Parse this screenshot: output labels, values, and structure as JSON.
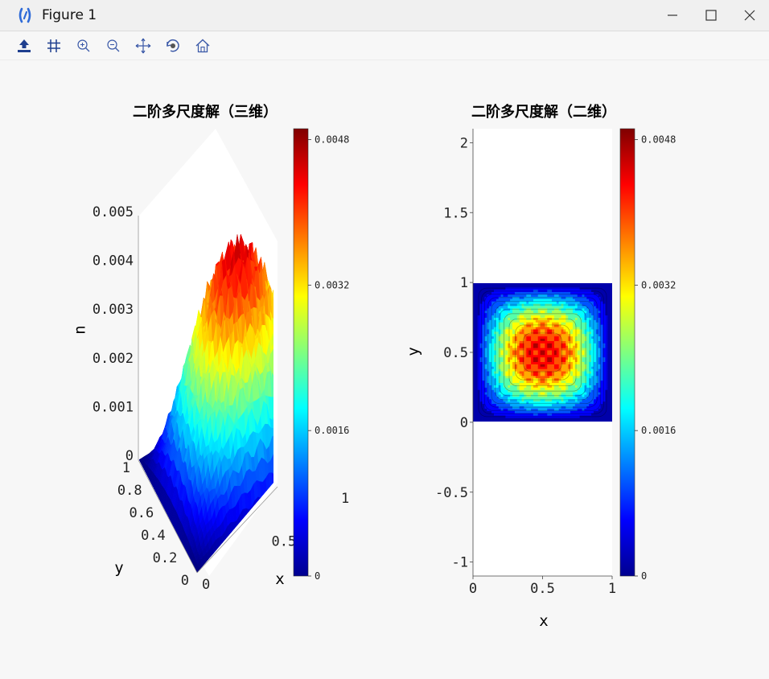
{
  "window": {
    "title": "Figure 1"
  },
  "toolbar": {
    "buttons": [
      {
        "name": "save-icon",
        "label": "Save"
      },
      {
        "name": "grid-icon",
        "label": "Grid"
      },
      {
        "name": "zoom-in-icon",
        "label": "Zoom in"
      },
      {
        "name": "zoom-out-icon",
        "label": "Zoom out"
      },
      {
        "name": "pan-icon",
        "label": "Pan"
      },
      {
        "name": "rotate-icon",
        "label": "Rotate"
      },
      {
        "name": "home-icon",
        "label": "Home"
      }
    ]
  },
  "chart_data": [
    {
      "type": "surface",
      "title": "二阶多尺度解（三维）",
      "xlabel": "x",
      "ylabel": "y",
      "zlabel": "u",
      "x_ticks": [
        "0",
        "0.5",
        "1"
      ],
      "y_ticks": [
        "0",
        "0.2",
        "0.4",
        "0.6",
        "0.8",
        "1"
      ],
      "z_ticks": [
        "0",
        "0.001",
        "0.002",
        "0.003",
        "0.004",
        "0.005"
      ],
      "xlim": [
        0,
        1
      ],
      "ylim": [
        0,
        1
      ],
      "zlim": [
        0,
        0.005
      ],
      "peak_value": 0.0049,
      "colormap": "jet",
      "colorbar": {
        "ticks": [
          "0",
          "0.0016",
          "0.0032",
          "0.0048"
        ],
        "min": 0,
        "max": 0.00492
      }
    },
    {
      "type": "heatmap",
      "title": "二阶多尺度解（二维）",
      "xlabel": "x",
      "ylabel": "y",
      "x_ticks": [
        "0",
        "0.5",
        "1"
      ],
      "y_ticks": [
        "-1",
        "-0.5",
        "0",
        "0.5",
        "1",
        "1.5",
        "2"
      ],
      "xlim": [
        0,
        1
      ],
      "ylim": [
        -1.1,
        2.1
      ],
      "data_extent": {
        "x": [
          0,
          1
        ],
        "y": [
          0,
          1
        ]
      },
      "peak_value": 0.0049,
      "colormap": "jet",
      "colorbar": {
        "ticks": [
          "0",
          "0.0016",
          "0.0032",
          "0.0048"
        ],
        "min": 0,
        "max": 0.00492
      }
    }
  ]
}
